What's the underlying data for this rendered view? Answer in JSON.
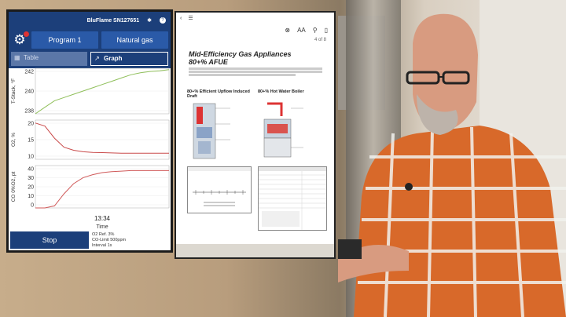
{
  "app": {
    "device_name": "BluFlame SN127651",
    "buttons": [
      "Program 1",
      "Natural gas"
    ],
    "tabs": [
      "Table",
      "Graph"
    ],
    "time_label": "13:34",
    "time_axis": "Time",
    "stop_label": "Stop",
    "info_lines": [
      "O2 Ref.   3%",
      "CO-Limit        500ppm",
      "Interval   1s"
    ]
  },
  "chart_data": [
    {
      "type": "line",
      "ylabel": "T-Stack, °F",
      "yticks": [
        "242",
        "240",
        "238"
      ],
      "series": [
        {
          "values": [
            236,
            237,
            238,
            238.5,
            239,
            239.5,
            240,
            240.5,
            241,
            241.5,
            242,
            242.3,
            242.5,
            242.6,
            242.8
          ]
        }
      ]
    },
    {
      "type": "line",
      "ylabel": "O2, %",
      "yticks": [
        "20",
        "15",
        "10"
      ],
      "series": [
        {
          "values": [
            20,
            19,
            15,
            12,
            11,
            10.5,
            10.3,
            10.2,
            10.1,
            10,
            10,
            10,
            10,
            10,
            10
          ]
        }
      ]
    },
    {
      "type": "line",
      "ylabel": "CO 0%O2, pt",
      "yticks": [
        "40",
        "30",
        "20",
        "10",
        "0"
      ],
      "series": [
        {
          "values": [
            0,
            0,
            2,
            14,
            24,
            30,
            33,
            35,
            36,
            36.5,
            37,
            37,
            37,
            37,
            37
          ]
        }
      ]
    }
  ],
  "doc": {
    "page_label": "4 of 8",
    "title_line1": "Mid-Efficiency Gas Appliances",
    "title_line2": "80+% AFUE",
    "sub_left": "80+% Efficient Upflow Induced Draft",
    "sub_right": "80+% Hot Water Boiler"
  }
}
